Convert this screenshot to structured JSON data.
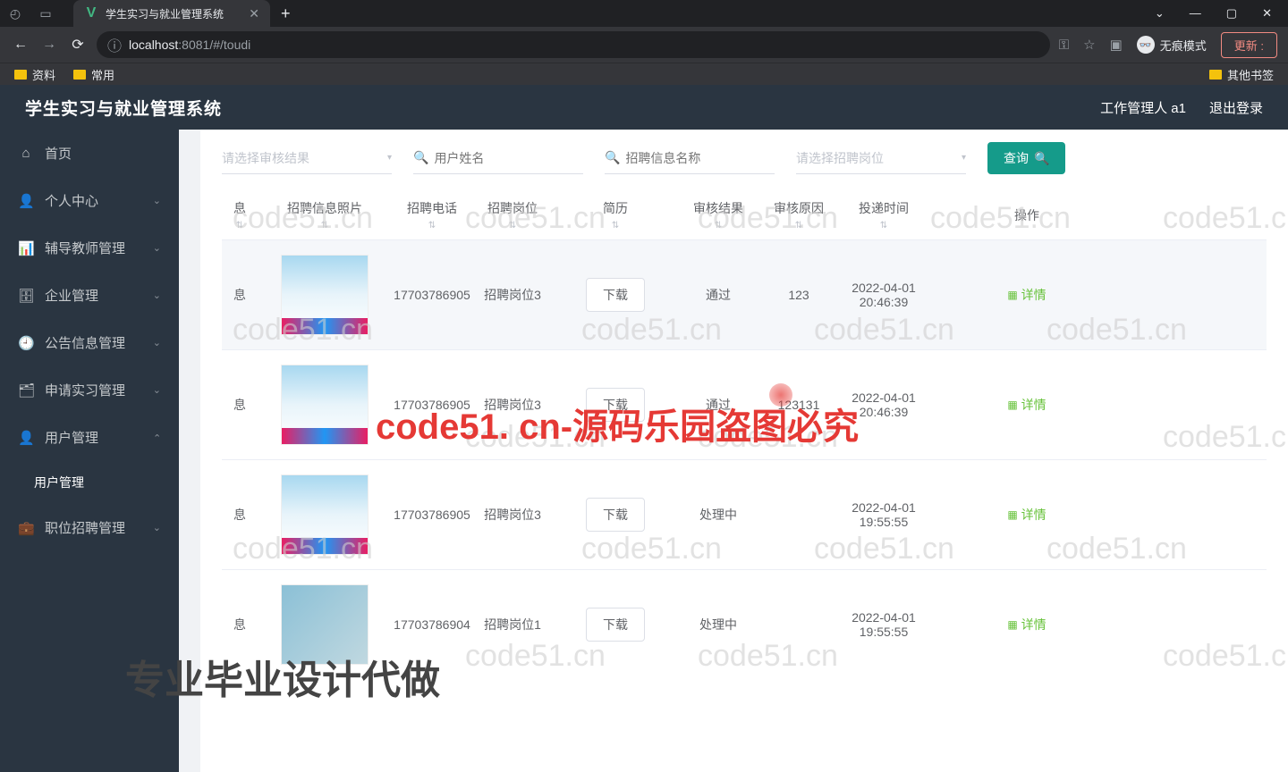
{
  "browser": {
    "tab_title": "学生实习与就业管理系统",
    "url_host": "localhost",
    "url_port": ":8081",
    "url_path": "/#/toudi",
    "incognito_label": "无痕模式",
    "update_label": "更新 :",
    "bookmarks": [
      "资料",
      "常用"
    ],
    "other_bookmarks": "其他书签"
  },
  "header": {
    "title": "学生实习与就业管理系统",
    "user": "工作管理人 a1",
    "logout": "退出登录"
  },
  "sidebar": {
    "items": [
      {
        "icon": "⌂",
        "label": "首页",
        "arrow": false
      },
      {
        "icon": "👤",
        "label": "个人中心",
        "arrow": true
      },
      {
        "icon": "📊",
        "label": "辅导教师管理",
        "arrow": true
      },
      {
        "icon": "🗄",
        "label": "企业管理",
        "arrow": true
      },
      {
        "icon": "🕘",
        "label": "公告信息管理",
        "arrow": true
      },
      {
        "icon": "🗂",
        "label": "申请实习管理",
        "arrow": true
      },
      {
        "icon": "👤",
        "label": "用户管理",
        "arrow": true,
        "expanded": true,
        "children": [
          "用户管理"
        ]
      },
      {
        "icon": "💼",
        "label": "职位招聘管理",
        "arrow": true
      }
    ]
  },
  "filters": {
    "select1_placeholder": "请选择审核结果",
    "input1_placeholder": "用户姓名",
    "input2_placeholder": "招聘信息名称",
    "select2_placeholder": "请选择招聘岗位",
    "query_label": "查询"
  },
  "table": {
    "headers": {
      "xi": "息",
      "photo": "招聘信息照片",
      "phone": "招聘电话",
      "job": "招聘岗位",
      "resume": "简历",
      "result": "审核结果",
      "reason": "审核原因",
      "time": "投递时间",
      "action": "操作"
    },
    "download_label": "下载",
    "detail_label": "详情",
    "rows": [
      {
        "xi": "息",
        "phone": "17703786905",
        "job": "招聘岗位3",
        "result": "通过",
        "reason": "123",
        "time": "2022-04-01 20:46:39"
      },
      {
        "xi": "息",
        "phone": "17703786905",
        "job": "招聘岗位3",
        "result": "通过",
        "reason": "123131",
        "time": "2022-04-01 20:46:39"
      },
      {
        "xi": "息",
        "phone": "17703786905",
        "job": "招聘岗位3",
        "result": "处理中",
        "reason": "",
        "time": "2022-04-01 19:55:55"
      },
      {
        "xi": "息",
        "phone": "17703786904",
        "job": "招聘岗位1",
        "result": "处理中",
        "reason": "",
        "time": "2022-04-01 19:55:55"
      }
    ]
  },
  "watermarks": {
    "text": "code51.cn",
    "red": "code51. cn-源码乐园盗图必究",
    "big": "专业毕业设计代做"
  }
}
